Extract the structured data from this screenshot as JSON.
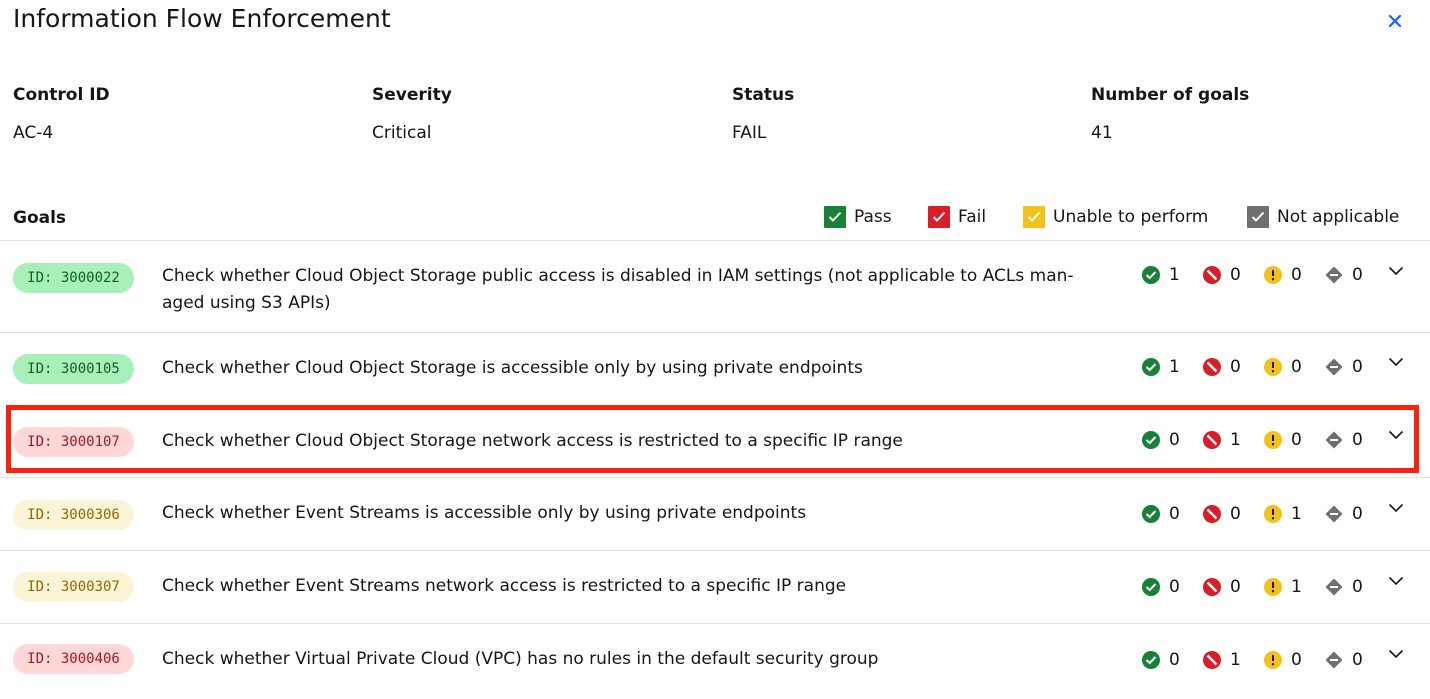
{
  "title": "Information Flow Enforcement",
  "meta": {
    "control_id_label": "Control ID",
    "control_id_value": "AC-4",
    "severity_label": "Severity",
    "severity_value": "Critical",
    "status_label": "Status",
    "status_value": "FAIL",
    "goals_count_label": "Number of goals",
    "goals_count_value": "41"
  },
  "goals_label": "Goals",
  "legend": {
    "pass": "Pass",
    "fail": "Fail",
    "unable": "Unable to perform",
    "na": "Not applicable"
  },
  "colors": {
    "pass": "#198038",
    "fail": "#da1e28",
    "warn": "#f1c21b",
    "na": "#6f6f6f",
    "highlight": "#ff1f0f"
  },
  "goals": [
    {
      "id": "ID: 3000022",
      "desc": "Check whether Cloud Object Storage public access is disabled in IAM settings (not applicable to ACLs man-aged using S3 APIs)",
      "status": "pass",
      "pass": "1",
      "fail": "0",
      "unable": "0",
      "na": "0"
    },
    {
      "id": "ID: 3000105",
      "desc": "Check whether Cloud Object Storage is accessible only by using private endpoints",
      "status": "pass",
      "pass": "1",
      "fail": "0",
      "unable": "0",
      "na": "0"
    },
    {
      "id": "ID: 3000107",
      "desc": "Check whether Cloud Object Storage network access is restricted to a specific IP range",
      "status": "fail",
      "pass": "0",
      "fail": "1",
      "unable": "0",
      "na": "0"
    },
    {
      "id": "ID: 3000306",
      "desc": "Check whether Event Streams is accessible only by using private endpoints",
      "status": "warn",
      "pass": "0",
      "fail": "0",
      "unable": "1",
      "na": "0"
    },
    {
      "id": "ID: 3000307",
      "desc": "Check whether Event Streams network access is restricted to a specific IP range",
      "status": "warn",
      "pass": "0",
      "fail": "0",
      "unable": "1",
      "na": "0"
    },
    {
      "id": "ID: 3000406",
      "desc": "Check whether Virtual Private Cloud (VPC) has no rules in the default security group",
      "status": "fail",
      "pass": "0",
      "fail": "1",
      "unable": "0",
      "na": "0"
    }
  ]
}
